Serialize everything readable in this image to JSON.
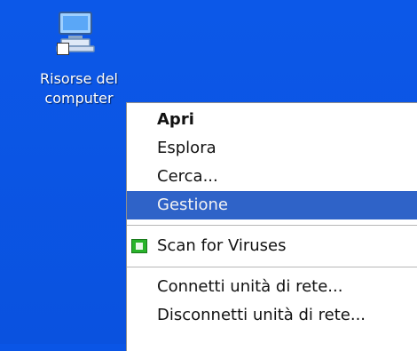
{
  "desktop": {
    "icon_label_line1": "Risorse del",
    "icon_label_line2": "computer"
  },
  "context_menu": {
    "items": [
      {
        "label": "Apri",
        "bold": true
      },
      {
        "label": "Esplora"
      },
      {
        "label": "Cerca..."
      },
      {
        "label": "Gestione",
        "selected": true
      },
      {
        "label": "Scan for Viruses",
        "icon": "virus-scan-icon"
      },
      {
        "label": "Connetti unità di rete..."
      },
      {
        "label": "Disconnetti unità di rete..."
      }
    ]
  },
  "colors": {
    "desktop_bg": "#0a55e6",
    "selected_bg": "#2f63c8",
    "menu_bg": "#ffffff"
  }
}
